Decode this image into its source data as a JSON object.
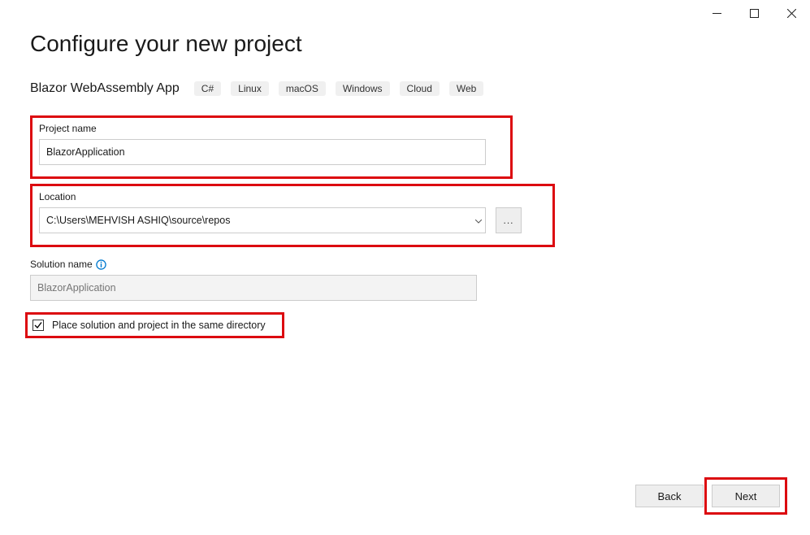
{
  "window": {
    "minimize": "minimize-icon",
    "maximize": "maximize-icon",
    "close": "close-icon"
  },
  "title": "Configure your new project",
  "template": {
    "name": "Blazor WebAssembly App",
    "tags": [
      "C#",
      "Linux",
      "macOS",
      "Windows",
      "Cloud",
      "Web"
    ]
  },
  "project_name": {
    "label": "Project name",
    "value": "BlazorApplication"
  },
  "location": {
    "label": "Location",
    "value": "C:\\Users\\MEHVISH ASHIQ\\source\\repos",
    "browse": "..."
  },
  "solution_name": {
    "label": "Solution name",
    "value": "",
    "placeholder": "BlazorApplication"
  },
  "same_dir": {
    "checked": true,
    "label": "Place solution and project in the same directory"
  },
  "footer": {
    "back": "Back",
    "next": "Next"
  }
}
